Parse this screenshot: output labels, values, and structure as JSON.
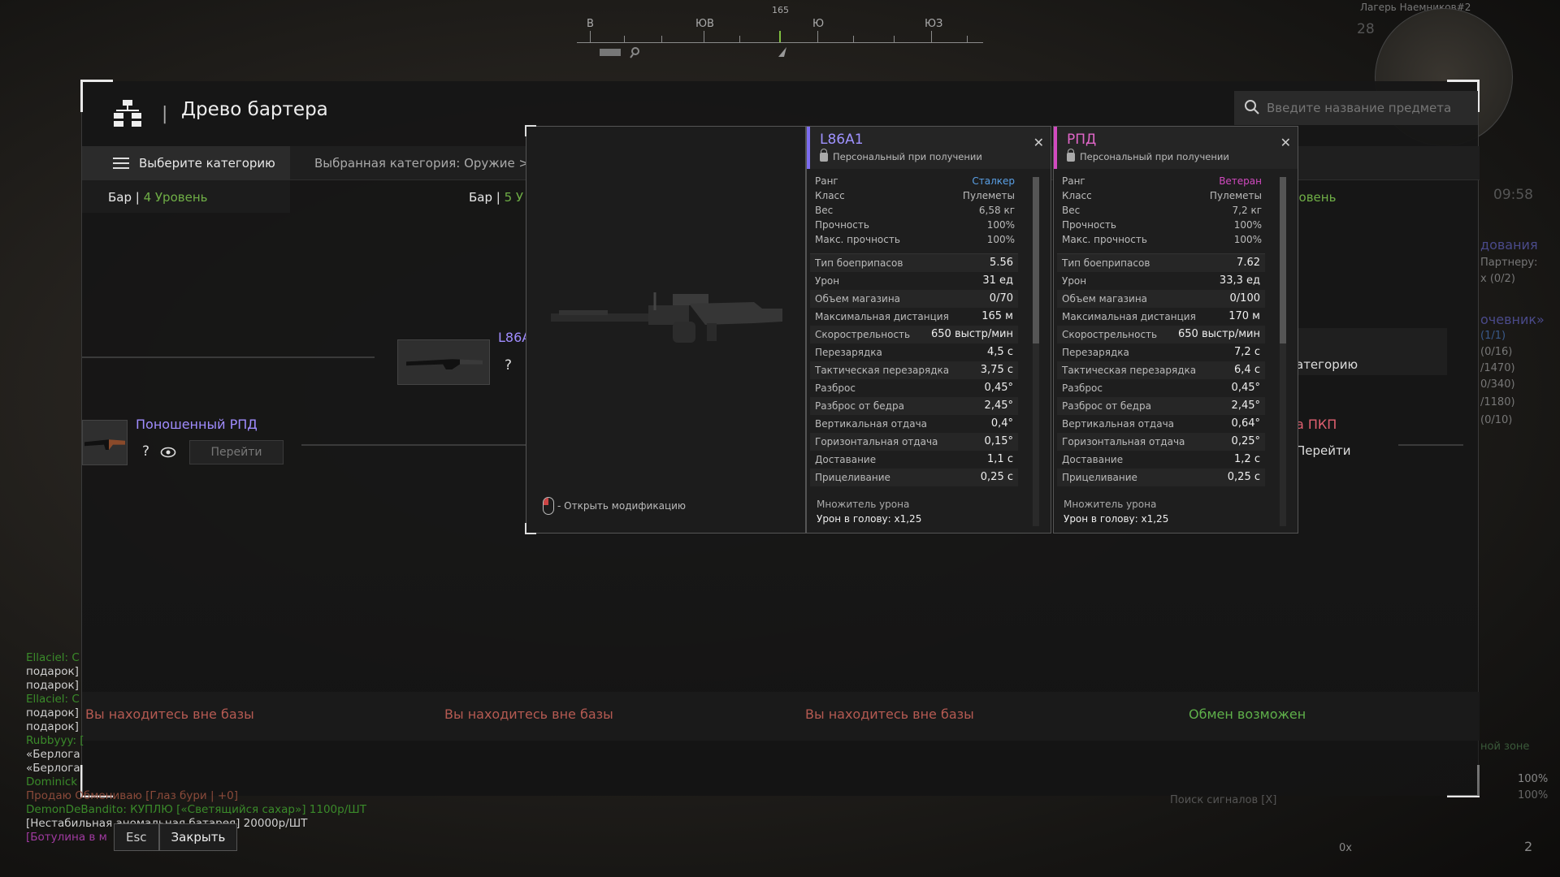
{
  "compass": {
    "degree": "165",
    "labels": [
      "В",
      "ЮВ",
      "Ю",
      "ЮЗ"
    ]
  },
  "hud": {
    "location": "Лагерь Наемников#2",
    "counter": "28",
    "time": "09:58",
    "right_fragments": [
      "дования",
      "Партнеру:",
      "х (0/2)",
      "очевник»",
      "(1/1)",
      "(0/16)",
      "/1470)",
      "0/340)",
      "/1180)",
      "(0/10)"
    ],
    "zone": "ной зоне",
    "pct1": "100%",
    "pct2": "100%",
    "signal": "Поиск сигналов [X]",
    "bottom_num": "2",
    "zero": "0x"
  },
  "panel": {
    "title": "Древо бартера",
    "search_placeholder": "Введите название предмета",
    "category_button": "Выберите категорию",
    "selected_category": "Выбранная категория: Оружие > Пу"
  },
  "levels": [
    {
      "prefix": "Бар",
      "level": "4 Уровень"
    },
    {
      "prefix": "Бар",
      "level": "5 У"
    },
    {
      "prefix": "",
      "level": "ровень"
    }
  ],
  "nodes": {
    "l86_name": "L86A",
    "rpd_name": "Поношенный РПД",
    "go_label": "Перейти",
    "right_btn": "атегорию",
    "pkp_name": "а ПКП",
    "right_go": "Перейти"
  },
  "statuses": [
    "Вы находитесь вне базы",
    "Вы находитесь вне базы",
    "Вы находитесь вне базы",
    "Обмен возможен"
  ],
  "viewer": {
    "hint": "- Открыть модификацию"
  },
  "cards": [
    {
      "name": "L86A1",
      "accent": "#7c6cf0",
      "name_color": "#9f92ff",
      "personal": "Персональный при получении",
      "basic": [
        {
          "k": "Ранг",
          "v": "Сталкер",
          "color": "#5aa0e6"
        },
        {
          "k": "Класс",
          "v": "Пулеметы"
        },
        {
          "k": "Вес",
          "v": "6,58 кг"
        },
        {
          "k": "Прочность",
          "v": "100%"
        },
        {
          "k": "Макс. прочность",
          "v": "100%"
        }
      ],
      "stats": [
        {
          "k": "Тип боеприпасов",
          "v": "5.56"
        },
        {
          "k": "Урон",
          "v": "31 ед"
        },
        {
          "k": "Объем магазина",
          "v": "0/70"
        },
        {
          "k": "Максимальная дистанция",
          "v": "165 м"
        },
        {
          "k": "Скорострельность",
          "v": "650 выстр/мин"
        },
        {
          "k": "Перезарядка",
          "v": "4,5 с"
        },
        {
          "k": "Тактическая перезарядка",
          "v": "3,75 с"
        },
        {
          "k": "Разброс",
          "v": "0,45°"
        },
        {
          "k": "Разброс от бедра",
          "v": "2,45°"
        },
        {
          "k": "Вертикальная отдача",
          "v": "0,4°"
        },
        {
          "k": "Горизонтальная отдача",
          "v": "0,15°"
        },
        {
          "k": "Доставание",
          "v": "1,1 с"
        },
        {
          "k": "Прицеливание",
          "v": "0,25 с"
        }
      ],
      "mult_title": "Множитель урона",
      "mult_head": "Урон в голову: x1,25"
    },
    {
      "name": "РПД",
      "accent": "#d24ac0",
      "name_color": "#e066c8",
      "personal": "Персональный при получении",
      "basic": [
        {
          "k": "Ранг",
          "v": "Ветеран",
          "color": "#d24ac0"
        },
        {
          "k": "Класс",
          "v": "Пулеметы"
        },
        {
          "k": "Вес",
          "v": "7,2 кг"
        },
        {
          "k": "Прочность",
          "v": "100%"
        },
        {
          "k": "Макс. прочность",
          "v": "100%"
        }
      ],
      "stats": [
        {
          "k": "Тип боеприпасов",
          "v": "7.62"
        },
        {
          "k": "Урон",
          "v": "33,3 ед"
        },
        {
          "k": "Объем магазина",
          "v": "0/100"
        },
        {
          "k": "Максимальная дистанция",
          "v": "170 м"
        },
        {
          "k": "Скорострельность",
          "v": "650 выстр/мин"
        },
        {
          "k": "Перезарядка",
          "v": "7,2 с"
        },
        {
          "k": "Тактическая перезарядка",
          "v": "6,4 с"
        },
        {
          "k": "Разброс",
          "v": "0,45°"
        },
        {
          "k": "Разброс от бедра",
          "v": "2,45°"
        },
        {
          "k": "Вертикальная отдача",
          "v": "0,64°"
        },
        {
          "k": "Горизонтальная отдача",
          "v": "0,25°"
        },
        {
          "k": "Доставание",
          "v": "1,2 с"
        },
        {
          "k": "Прицеливание",
          "v": "0,25 с"
        }
      ],
      "mult_title": "Множитель урона",
      "mult_head": "Урон в голову: x1,25"
    }
  ],
  "chat": [
    {
      "text": "Ellaciel: C",
      "color": "#3a8a2a"
    },
    {
      "text": "подарок] ",
      "color": "#cfcfcf"
    },
    {
      "text": "подарок] ",
      "color": "#cfcfcf"
    },
    {
      "text": "Ellaciel: C",
      "color": "#3a8a2a"
    },
    {
      "text": "подарок] ",
      "color": "#cfcfcf"
    },
    {
      "text": "подарок] ",
      "color": "#cfcfcf"
    },
    {
      "text": "Rubbyyy: [",
      "color": "#3a8a2a"
    },
    {
      "text": "«Берлога",
      "color": "#cfcfcf"
    },
    {
      "text": "«Берлога",
      "color": "#cfcfcf"
    },
    {
      "text": "Dominick",
      "color": "#3a8a2a"
    },
    {
      "text": "Продаю Обмениваю [Глаз бури | +0]",
      "color": "#8a4a3a"
    },
    {
      "text": "DemonDeBandito: КУПЛЮ [«Светящийся сахар»] 1100р/ШТ",
      "color": "#3a8a2a"
    },
    {
      "text": "[Нестабильная аномальная батарея] 20000р/ШТ",
      "color": "#cfcfcf"
    },
    {
      "text": "[Ботулина в м",
      "color": "#a03aa0"
    }
  ],
  "keys": {
    "esc": "Esc",
    "close": "Закрыть"
  }
}
